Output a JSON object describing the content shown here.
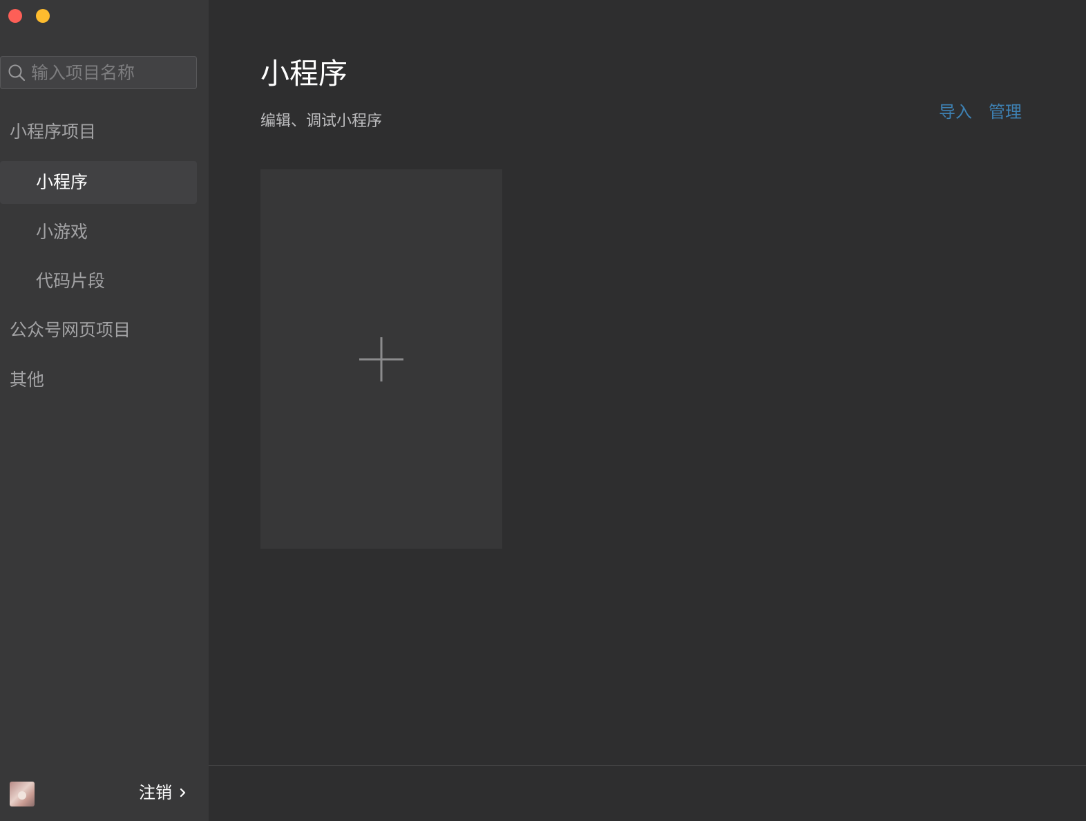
{
  "window": {
    "controls": [
      "close",
      "minimize"
    ],
    "colors": {
      "close": "#fd5f57",
      "minimize": "#febc2e"
    }
  },
  "sidebar": {
    "search": {
      "placeholder": "输入项目名称",
      "value": "",
      "icon": "search-icon"
    },
    "groups": [
      {
        "label": "小程序项目",
        "items": [
          {
            "label": "小程序",
            "active": true
          },
          {
            "label": "小游戏",
            "active": false
          },
          {
            "label": "代码片段",
            "active": false
          }
        ]
      },
      {
        "label": "公众号网页项目",
        "items": []
      },
      {
        "label": "其他",
        "items": []
      }
    ],
    "footer": {
      "avatar": "user-avatar",
      "logout_label": "注销",
      "logout_icon": "chevron-right-icon"
    }
  },
  "main": {
    "title": "小程序",
    "subtitle": "编辑、调试小程序",
    "actions": {
      "import_label": "导入",
      "manage_label": "管理"
    },
    "new_card_icon": "plus-icon"
  },
  "colors": {
    "accent_link": "#3e82b5",
    "sidebar_bg": "#383839",
    "main_bg": "#2e2e2f",
    "card_bg": "#373738",
    "active_item_bg": "#414143"
  }
}
